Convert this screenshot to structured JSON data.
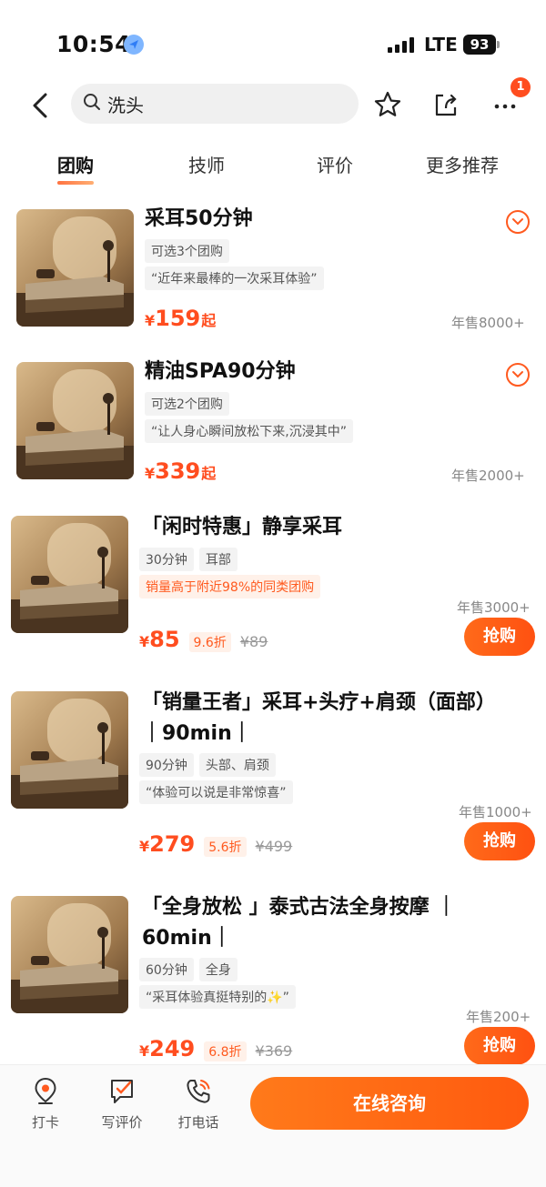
{
  "status": {
    "time": "10:54",
    "network": "LTE",
    "battery": "93"
  },
  "search": {
    "query": "洗头"
  },
  "notification_count": "1",
  "tabs": [
    {
      "label": "团购"
    },
    {
      "label": "技师"
    },
    {
      "label": "评价"
    },
    {
      "label": "更多推荐"
    }
  ],
  "deals": [
    {
      "title": "采耳50分钟",
      "tags": [
        "可选3个团购"
      ],
      "quote": "“近年来最棒的一次采耳体验”",
      "currency": "¥",
      "price": "159",
      "price_suffix": "起",
      "sales": "年售8000+"
    },
    {
      "title": "精油SPA90分钟",
      "tags": [
        "可选2个团购"
      ],
      "quote": "“让人身心瞬间放松下来,沉浸其中”",
      "currency": "¥",
      "price": "339",
      "price_suffix": "起",
      "sales": "年售2000+"
    },
    {
      "title": "「闲时特惠」静享采耳",
      "tags": [
        "30分钟",
        "耳部"
      ],
      "highlight": "销量高于附近98%的同类团购",
      "currency": "¥",
      "price": "85",
      "discount": "9.6折",
      "original": "¥89",
      "sales": "年售3000+",
      "buy_label": "抢购"
    },
    {
      "title_line1": "「销量王者」采耳+头疗+肩颈（面部）",
      "title_line2": "｜90min｜",
      "tags": [
        "90分钟",
        "头部、肩颈"
      ],
      "quote": "“体验可以说是非常惊喜”",
      "currency": "¥",
      "price": "279",
      "discount": "5.6折",
      "original": "¥499",
      "sales": "年售1000+",
      "buy_label": "抢购"
    },
    {
      "title_line1": "「全身放松 」泰式古法全身按摩 ｜",
      "title_line2": "60min｜",
      "tags": [
        "60分钟",
        "全身"
      ],
      "quote": "“采耳体验真挺特别的✨”",
      "currency": "¥",
      "price": "249",
      "discount": "6.8折",
      "original": "¥369",
      "sales": "年售200+",
      "buy_label": "抢购"
    }
  ],
  "bottom": {
    "checkin": "打卡",
    "review": "写评价",
    "call": "打电话",
    "consult": "在线咨询"
  },
  "colors": {
    "accent": "#ff5a1f",
    "price": "#ff4d1f"
  },
  "icons": [
    "location-icon",
    "back-icon",
    "search-icon",
    "star-icon",
    "share-icon",
    "more-icon",
    "chevron-down-icon",
    "pin-icon",
    "edit-icon",
    "phone-icon"
  ]
}
